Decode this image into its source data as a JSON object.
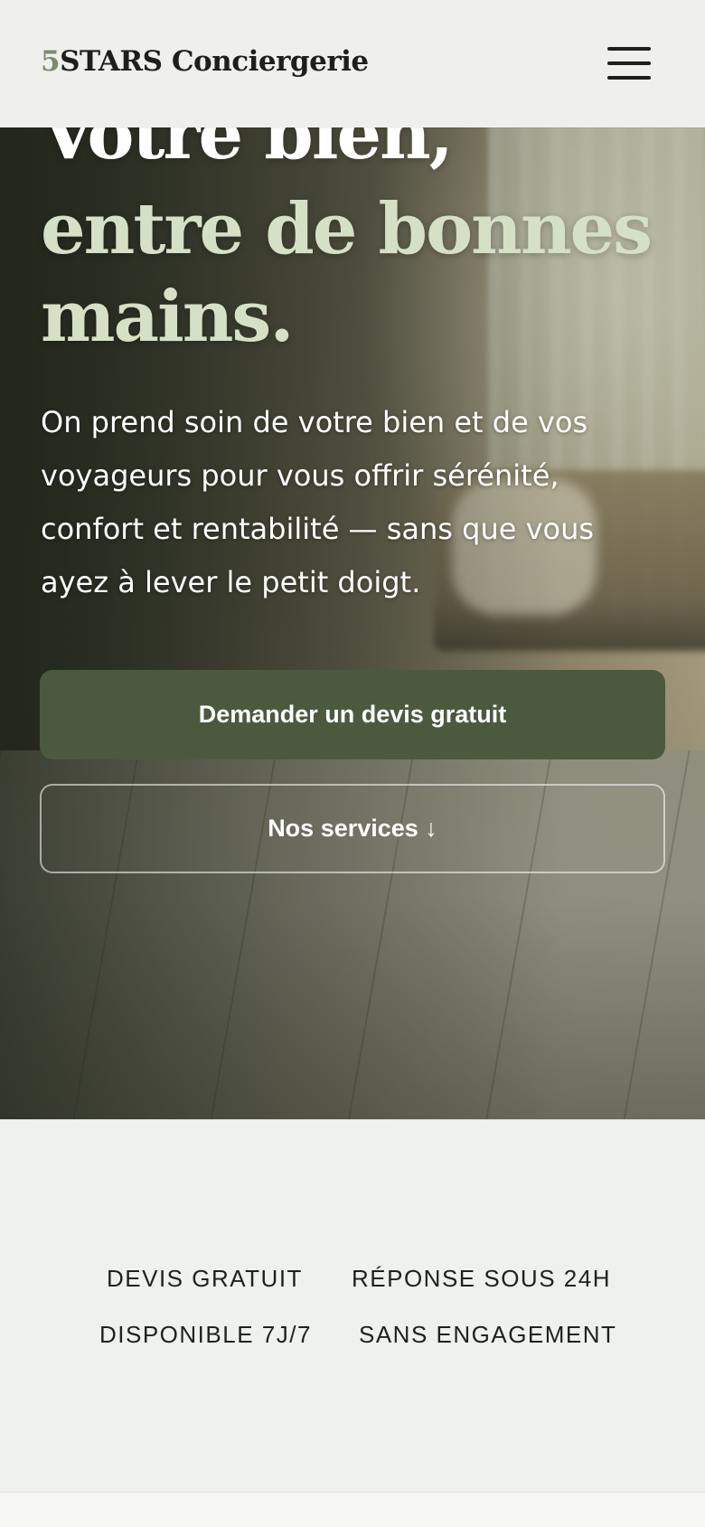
{
  "header": {
    "brand_number": "5",
    "brand_name": "STARS Conciergerie"
  },
  "hero": {
    "title_line1": "Votre bien,",
    "title_line2": "entre de bonnes",
    "title_line3": "mains.",
    "lead": "On prend soin de votre bien et de vos voyageurs pour vous offrir sérénité, confort et rentabilité — sans que vous ayez à lever le petit doigt.",
    "cta_primary": "Demander un devis gratuit",
    "cta_secondary": "Nos services ↓"
  },
  "trust": {
    "items": [
      "DEVIS GRATUIT",
      "RÉPONSE SOUS 24H",
      "DISPONIBLE 7J/7",
      "SANS ENGAGEMENT"
    ]
  },
  "colors": {
    "accent": "#4b5a3f",
    "title_accent": "#d5e0c6",
    "brand_number": "#7d8a6e"
  },
  "icons": [
    "hamburger-menu-icon",
    "arrow-down-icon"
  ]
}
